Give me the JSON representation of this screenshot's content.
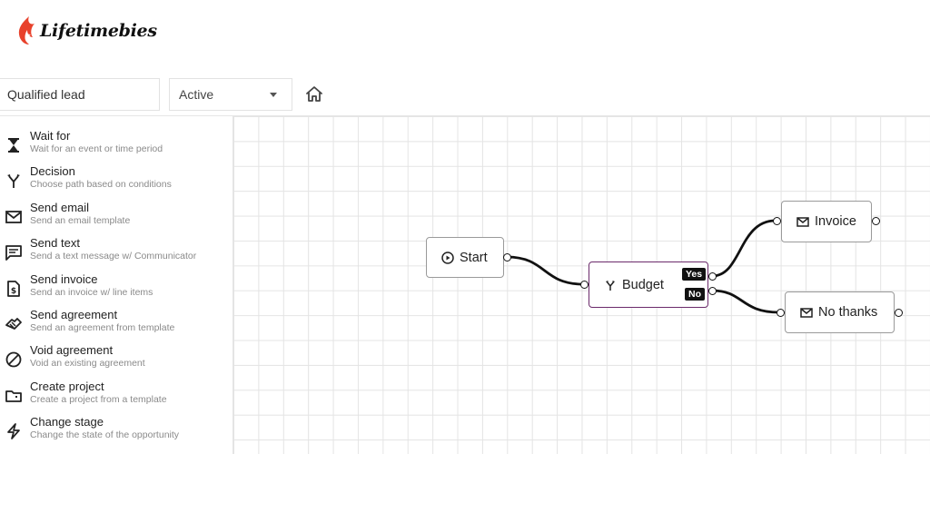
{
  "brand": {
    "name": "Lifetimebies",
    "accent": "#e8412b"
  },
  "toolbar": {
    "name_value": "Qualified lead",
    "status_value": "Active",
    "home_icon": "home-icon"
  },
  "sidebar": {
    "items": [
      {
        "title": "Wait for",
        "desc": "Wait for an event or time period",
        "icon": "hourglass-icon"
      },
      {
        "title": "Decision",
        "desc": "Choose path based on conditions",
        "icon": "split-icon"
      },
      {
        "title": "Send email",
        "desc": "Send an email template",
        "icon": "mail-icon"
      },
      {
        "title": "Send text",
        "desc": "Send a text message w/ Communicator",
        "icon": "message-icon"
      },
      {
        "title": "Send invoice",
        "desc": "Send an invoice w/ line items",
        "icon": "invoice-icon"
      },
      {
        "title": "Send agreement",
        "desc": "Send an agreement from template",
        "icon": "handshake-icon"
      },
      {
        "title": "Void agreement",
        "desc": "Void an existing agreement",
        "icon": "ban-icon"
      },
      {
        "title": "Create project",
        "desc": "Create a project from a template",
        "icon": "folder-icon"
      },
      {
        "title": "Change stage",
        "desc": "Change the state of the opportunity",
        "icon": "bolt-icon"
      }
    ]
  },
  "flow": {
    "nodes": {
      "start": {
        "label": "Start",
        "icon": "play-icon"
      },
      "budget": {
        "label": "Budget",
        "icon": "split-icon",
        "yes_label": "Yes",
        "no_label": "No"
      },
      "invoice": {
        "label": "Invoice",
        "icon": "mail-icon"
      },
      "no_thanks": {
        "label": "No thanks",
        "icon": "mail-icon"
      }
    },
    "selected_color": "#6b2a6b"
  }
}
